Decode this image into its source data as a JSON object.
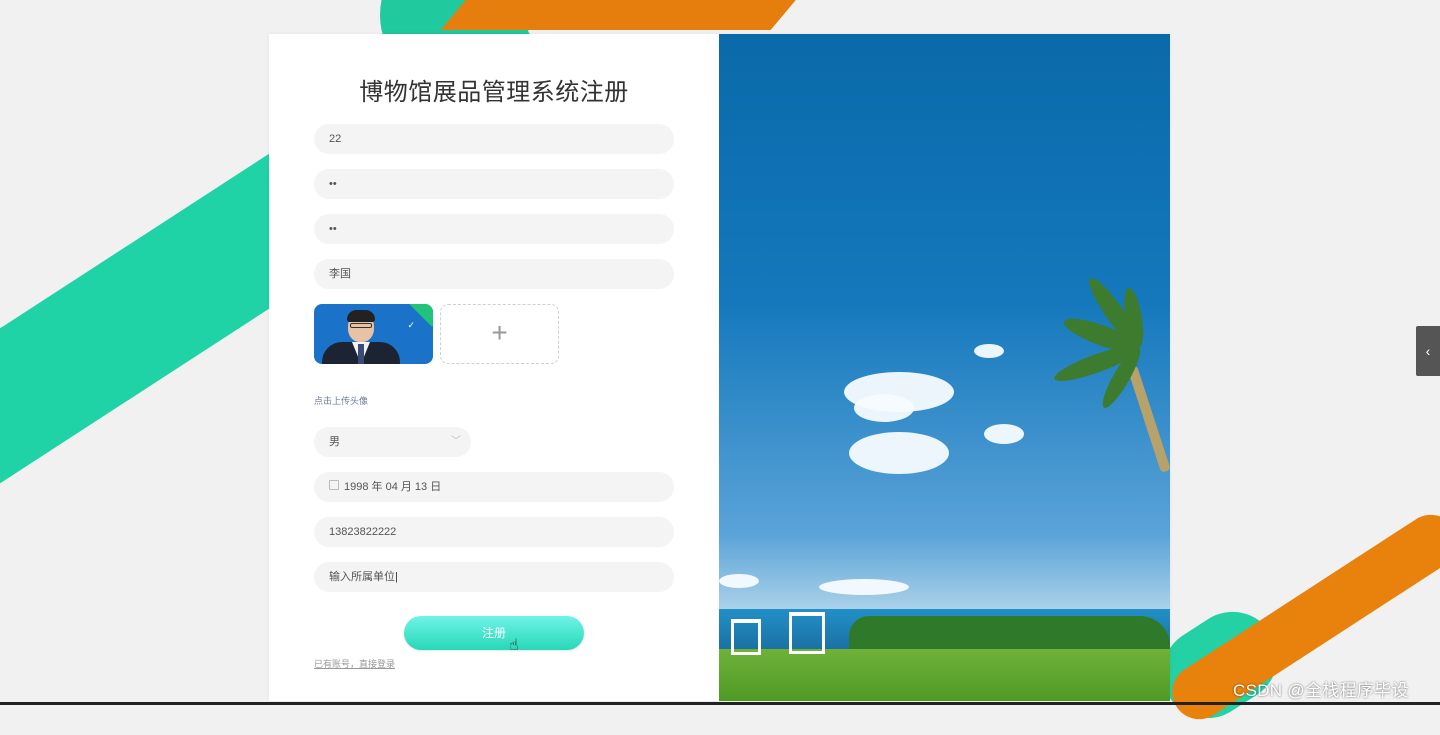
{
  "form": {
    "title": "博物馆展品管理系统注册",
    "fields": [
      {
        "value": "22"
      },
      {
        "value": "••"
      },
      {
        "value": "••"
      },
      {
        "value": "李国"
      }
    ],
    "upload_plus": "+",
    "upload_hint": "点击上传头像",
    "gender": "男",
    "birthday": "1998 年 04 月 13 日",
    "phone": "13823822222",
    "unit_placeholder": "输入所属单位",
    "submit_label": "注册",
    "login_link": "已有账号，直接登录"
  },
  "side_tab": "‹",
  "watermark": "CSDN @全栈程序毕设"
}
